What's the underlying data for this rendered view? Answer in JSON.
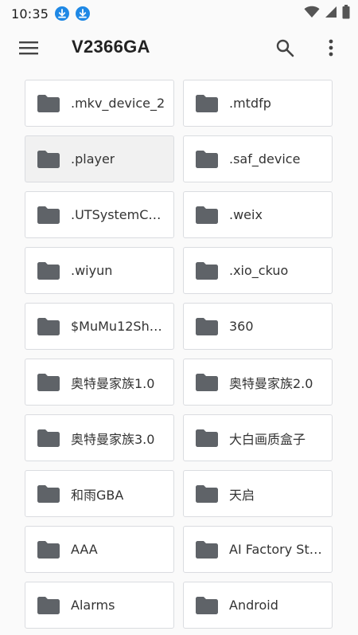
{
  "status_bar": {
    "time": "10:35",
    "icons": [
      "download-icon",
      "download-icon",
      "wifi-icon",
      "signal-icon",
      "battery-icon"
    ]
  },
  "toolbar": {
    "title": "V2366GA",
    "menu_icon": "menu-icon",
    "search_icon": "search-icon",
    "more_icon": "more-vert-icon"
  },
  "colors": {
    "folder": "#5f6368",
    "badge": "#1e88e5",
    "tile_border": "#dadce0",
    "selected_tile": "#f1f1f1"
  },
  "folders": [
    {
      "label": ".mkv_device_2"
    },
    {
      "label": ".mtdfp"
    },
    {
      "label": ".player",
      "selected": true
    },
    {
      "label": ".saf_device"
    },
    {
      "label": ".UTSystemC…"
    },
    {
      "label": ".weix"
    },
    {
      "label": ".wiyun"
    },
    {
      "label": ".xio_ckuo"
    },
    {
      "label": "$MuMu12Sh…"
    },
    {
      "label": "360"
    },
    {
      "label": "奥特曼家族1.0"
    },
    {
      "label": "奥特曼家族2.0"
    },
    {
      "label": "奥特曼家族3.0"
    },
    {
      "label": "大白画质盒子"
    },
    {
      "label": "和雨GBA"
    },
    {
      "label": "天启"
    },
    {
      "label": "AAA"
    },
    {
      "label": "AI Factory St…"
    },
    {
      "label": "Alarms"
    },
    {
      "label": "Android"
    }
  ]
}
